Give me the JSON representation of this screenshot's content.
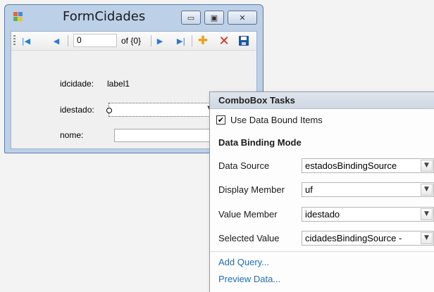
{
  "form": {
    "title": "FormCidades",
    "caption_buttons": {
      "minimize": "▭",
      "maximize": "▣",
      "close": "✕"
    },
    "navigator": {
      "position": "0",
      "count": "of {0}",
      "icons": [
        "move-first-icon",
        "move-previous-icon",
        "move-next-icon",
        "move-last-icon",
        "add-new-icon",
        "delete-icon",
        "save-icon"
      ]
    },
    "fields": {
      "idcidade_label": "idcidade:",
      "idcidade_value": "label1",
      "idestado_label": "idestado:",
      "nome_label": "nome:"
    },
    "smart_tag_glyph": "◂"
  },
  "tasks": {
    "title": "ComboBox Tasks",
    "use_data_bound_label": "Use Data Bound Items",
    "use_data_bound_checked": true,
    "section_title": "Data Binding Mode",
    "rows": [
      {
        "label": "Data Source",
        "value": "estadosBindingSource"
      },
      {
        "label": "Display Member",
        "value": "uf"
      },
      {
        "label": "Value Member",
        "value": "idestado"
      },
      {
        "label": "Selected Value",
        "value": "cidadesBindingSource -"
      }
    ],
    "links": {
      "add_query": "Add Query...",
      "preview_data": "Preview Data..."
    }
  },
  "colors": {
    "window_frame": "#bcd0e8",
    "accent_link": "#1f6fbf",
    "nav_blue": "#2b7bd6"
  }
}
